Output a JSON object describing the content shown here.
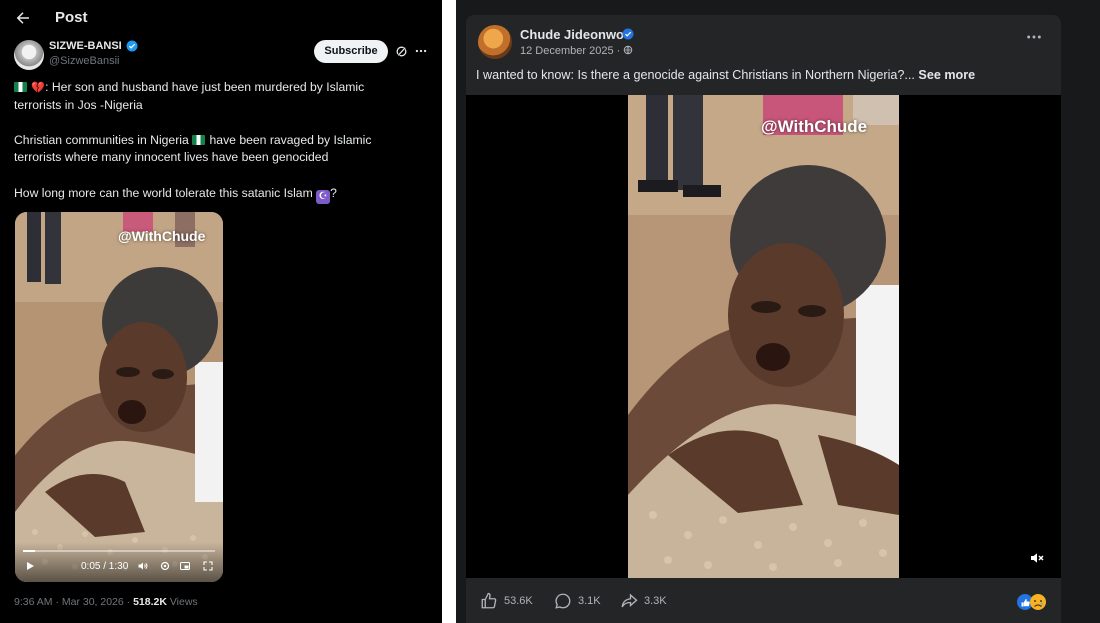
{
  "x_post": {
    "header_title": "Post",
    "author_name": "SIZWE-BANSI",
    "author_handle": "@SizweBansii",
    "subscribe_label": "Subscribe",
    "line1_text": ": Her son and husband have just been murdered by Islamic",
    "line2_text": "terrorists in Jos -Nigeria",
    "para2_part1": "Christian communities in Nigeria",
    "para2_part2": " have been ravaged by Islamic",
    "para2_line2": "terrorists where many innocent lives have been genocided",
    "para3_text": "How long more can the world tolerate this satanic Islam",
    "para3_end": "?",
    "heart_emoji": "💔",
    "moon_emoji": "☪",
    "video_watermark": "@WithChude",
    "video_time": "0:05 / 1:30",
    "video_progress": 0.06,
    "timestamp": "9:36 AM · Mar 30, 2026 · ",
    "views_count": "518.2K",
    "views_label": " Views",
    "icons": [
      "back-arrow-icon",
      "verified-badge-icon",
      "grok-icon",
      "more-icon",
      "play-icon",
      "volume-icon",
      "settings-icon",
      "pip-icon",
      "fullscreen-icon"
    ]
  },
  "fb_post": {
    "author_name": "Chude Jideonwo",
    "date": "12 December 2025 · ",
    "post_text": "I wanted to know: Is there a genocide against Christians in Northern Nigeria?... ",
    "see_more_label": "See more",
    "video_watermark": "@WithChude",
    "likes_count": "53.6K",
    "comments_count": "3.1K",
    "shares_count": "3.3K",
    "icons": [
      "verified-badge-icon",
      "globe-icon",
      "more-icon",
      "mute-icon",
      "like-icon",
      "comment-icon",
      "share-icon",
      "reactions-icon"
    ]
  },
  "colors": {
    "x_background": "#000000",
    "fb_background": "#18191a",
    "fb_card": "#242526",
    "verified_blue": "#1d9bf0",
    "fb_blue": "#2374e1"
  }
}
